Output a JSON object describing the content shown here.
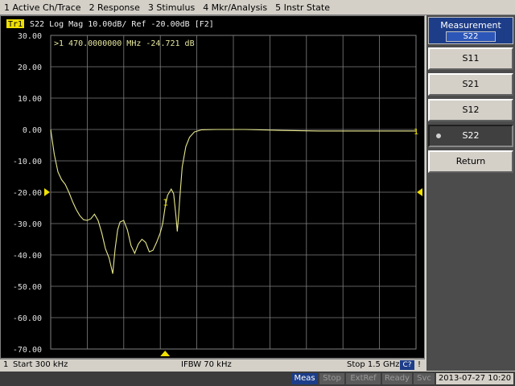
{
  "menu": [
    "1 Active Ch/Trace",
    "2 Response",
    "3 Stimulus",
    "4 Mkr/Analysis",
    "5 Instr State"
  ],
  "trace_header": {
    "tag": "Tr1",
    "text": "S22 Log Mag 10.00dB/ Ref -20.00dB [F2]"
  },
  "marker_readout": ">1  470.0000000 MHz -24.721 dB",
  "marker_label": "1",
  "end_label": "1",
  "colors": {
    "trace": "#e8e88c",
    "grid": "#808080",
    "background": "#000000",
    "accent": "#f0e000"
  },
  "chart_data": {
    "type": "line",
    "title": "S22 Log Mag 10.00dB/ Ref -20.00dB [F2]",
    "ylabel": "",
    "xlabel": "",
    "ylim": [
      -70,
      30
    ],
    "y_ticks": [
      "30.00",
      "20.00",
      "10.00",
      "0.00",
      "-10.00",
      "-20.00",
      "-30.00",
      "-40.00",
      "-50.00",
      "-60.00",
      "-70.00"
    ],
    "x_start_mhz": 0.3,
    "x_stop_mhz": 1500,
    "reference_level": -20,
    "series": [
      {
        "name": "Tr1",
        "points": [
          [
            0.3,
            0.0
          ],
          [
            15,
            -8.0
          ],
          [
            30,
            -13.5
          ],
          [
            45,
            -16.0
          ],
          [
            60,
            -17.5
          ],
          [
            75,
            -20.0
          ],
          [
            90,
            -23.0
          ],
          [
            105,
            -25.5
          ],
          [
            120,
            -27.5
          ],
          [
            135,
            -28.8
          ],
          [
            150,
            -29.0
          ],
          [
            165,
            -28.5
          ],
          [
            180,
            -27.0
          ],
          [
            195,
            -29.0
          ],
          [
            210,
            -33.0
          ],
          [
            225,
            -38.0
          ],
          [
            240,
            -41.0
          ],
          [
            255,
            -46.0
          ],
          [
            265,
            -38.0
          ],
          [
            275,
            -32.0
          ],
          [
            285,
            -29.5
          ],
          [
            300,
            -29.0
          ],
          [
            315,
            -32.0
          ],
          [
            330,
            -37.0
          ],
          [
            345,
            -39.5
          ],
          [
            360,
            -36.5
          ],
          [
            375,
            -35.0
          ],
          [
            390,
            -36.0
          ],
          [
            405,
            -39.0
          ],
          [
            420,
            -38.5
          ],
          [
            435,
            -36.0
          ],
          [
            450,
            -33.0
          ],
          [
            460,
            -30.0
          ],
          [
            470,
            -24.721
          ],
          [
            480,
            -21.0
          ],
          [
            495,
            -19.0
          ],
          [
            505,
            -20.5
          ],
          [
            515,
            -28.0
          ],
          [
            520,
            -32.5
          ],
          [
            525,
            -28.0
          ],
          [
            530,
            -22.0
          ],
          [
            540,
            -12.0
          ],
          [
            555,
            -5.5
          ],
          [
            570,
            -2.5
          ],
          [
            590,
            -0.8
          ],
          [
            620,
            -0.1
          ],
          [
            680,
            0.0
          ],
          [
            800,
            0.0
          ],
          [
            950,
            -0.3
          ],
          [
            1100,
            -0.5
          ],
          [
            1300,
            -0.5
          ],
          [
            1500,
            -0.5
          ]
        ]
      }
    ],
    "marker": {
      "id": 1,
      "x_mhz": 470,
      "value_db": -24.721
    }
  },
  "channel_status": {
    "channel": "1",
    "start": "Start 300 kHz",
    "ifbw": "IFBW 70 kHz",
    "stop": "Stop 1.5 GHz",
    "corr": "C?",
    "excl": "!"
  },
  "softkeys": {
    "title": "Measurement",
    "current": "S22",
    "buttons": [
      "S11",
      "S21",
      "S12",
      "S22",
      "Return"
    ],
    "active": "S22"
  },
  "status": {
    "meas": "Meas",
    "stop": "Stop",
    "extref": "ExtRef",
    "ready": "Ready",
    "svc": "Svc",
    "datetime": "2013-07-27 10:20"
  }
}
